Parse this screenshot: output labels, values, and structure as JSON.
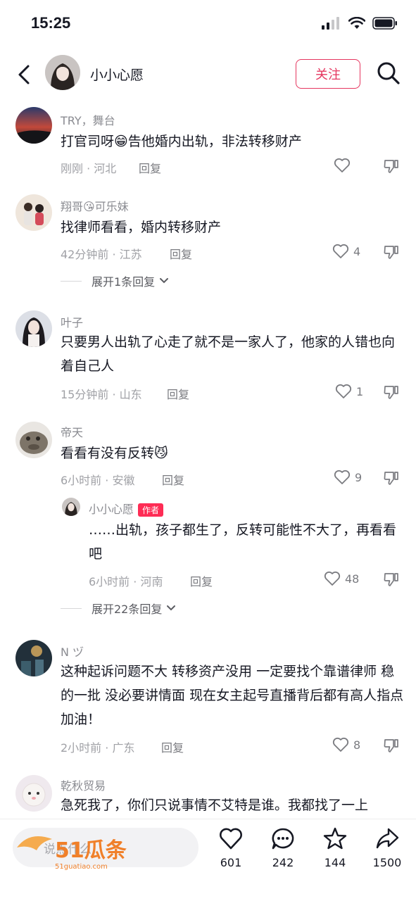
{
  "status": {
    "time": "15:25"
  },
  "header": {
    "name": "小小心愿",
    "follow_label": "关注"
  },
  "comments": [
    {
      "author": "TRY，舞台",
      "text": "打官司呀😁告他婚内出轨，非法转移财产",
      "meta": "刚刚 · 河北",
      "reply": "回复",
      "likes": ""
    },
    {
      "author": "翔哥😘可乐妹",
      "text": "找律师看看，婚内转移财产",
      "meta": "42分钟前 · 江苏",
      "reply": "回复",
      "likes": "4",
      "expand": "展开1条回复"
    },
    {
      "author": "叶子",
      "text": "只要男人出轨了心走了就不是一家人了，他家的人错也向着自己人",
      "meta": "15分钟前 · 山东",
      "reply": "回复",
      "likes": "1"
    },
    {
      "author": "帝天",
      "text": "看看有没有反转😼",
      "meta": "6小时前 · 安徽",
      "reply": "回复",
      "likes": "9"
    },
    {
      "author": "N ヅ",
      "text": "这种起诉问题不大 转移资产没用 一定要找个靠谱律师 稳的一批 没必要讲情面 现在女主起号直播背后都有高人指点 加油！",
      "meta": "2小时前 · 广东",
      "reply": "回复",
      "likes": "8"
    },
    {
      "author": "乾秋贸易",
      "text": "急死我了，你们只说事情不艾特是谁。我都找了一上"
    }
  ],
  "sub_reply": {
    "author": "小小心愿",
    "tag": "作者",
    "text": "……出轨，孩子都生了，反转可能性不大了，再看看吧",
    "meta": "6小时前 · 河南",
    "reply": "回复",
    "likes": "48",
    "expand": "展开22条回复"
  },
  "bottom": {
    "placeholder": "说点什么...",
    "actions": [
      {
        "icon": "heart-icon",
        "count": "601"
      },
      {
        "icon": "comment-icon",
        "count": "242"
      },
      {
        "icon": "star-icon",
        "count": "144"
      },
      {
        "icon": "share-icon",
        "count": "1500"
      }
    ]
  },
  "watermark": {
    "brand": "51瓜条",
    "url": "51guatiao.com"
  }
}
